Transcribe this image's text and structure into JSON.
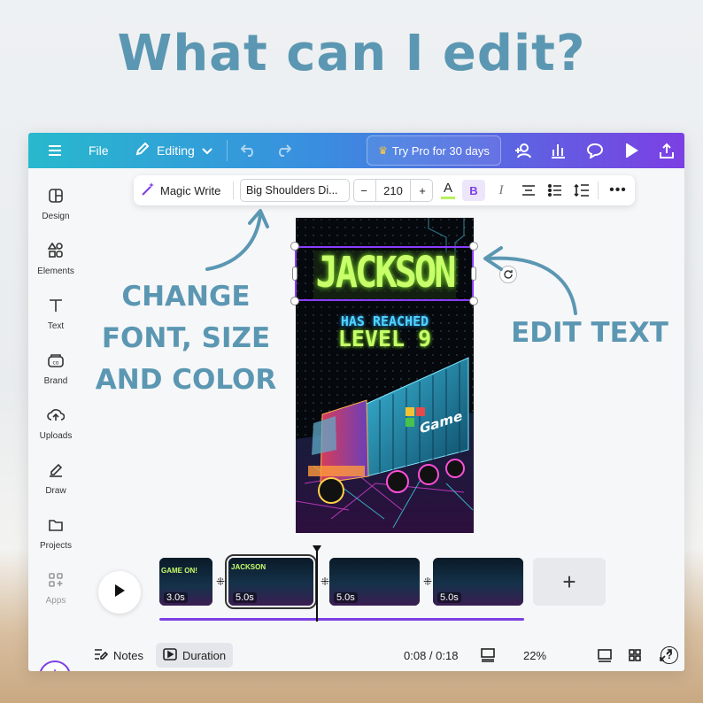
{
  "promo": {
    "title": "What can I edit?",
    "annotation_left": "CHANGE\nFONT, SIZE\nAND COLOR",
    "annotation_right": "EDIT TEXT"
  },
  "colors": {
    "accent": "#5b97b2",
    "brand_gradient_start": "#27b9cd",
    "brand_gradient_end": "#7c3fe3",
    "selection": "#8b3dff"
  },
  "topbar": {
    "menu_icon": "hamburger-icon",
    "file_label": "File",
    "mode_label": "Editing",
    "pro_label": "Try Pro for 30 days",
    "right_icons": [
      "share-people-icon",
      "insights-chart-icon",
      "comment-icon",
      "present-play-icon",
      "upload-share-icon"
    ]
  },
  "sidebar": {
    "items": [
      {
        "label": "Design",
        "icon": "design-icon"
      },
      {
        "label": "Elements",
        "icon": "elements-icon"
      },
      {
        "label": "Text",
        "icon": "text-icon"
      },
      {
        "label": "Brand",
        "icon": "brand-icon"
      },
      {
        "label": "Uploads",
        "icon": "uploads-icon"
      },
      {
        "label": "Draw",
        "icon": "draw-icon"
      },
      {
        "label": "Projects",
        "icon": "projects-icon"
      },
      {
        "label": "Apps",
        "icon": "apps-icon"
      }
    ]
  },
  "toolbar": {
    "magic_write_label": "Magic Write",
    "font_name": "Big Shoulders Di...",
    "decrease": "−",
    "font_size": "210",
    "increase": "+",
    "color_label": "A",
    "bold_label": "B",
    "italic_label": "I"
  },
  "canvas": {
    "headline": "JACKSON",
    "line1": "HAS REACHED",
    "line2": "LEVEL 9",
    "truck_logo": "Game"
  },
  "timeline": {
    "clips": [
      {
        "duration": "3.0s",
        "thumb_text": "GAME ON!"
      },
      {
        "duration": "5.0s",
        "thumb_text": "JACKSON"
      },
      {
        "duration": "5.0s",
        "thumb_text": ""
      },
      {
        "duration": "5.0s",
        "thumb_text": ""
      }
    ],
    "add_label": "+"
  },
  "bottombar": {
    "notes_label": "Notes",
    "duration_label": "Duration",
    "time": "0:08 / 0:18",
    "zoom": "22%",
    "help_label": "?"
  }
}
